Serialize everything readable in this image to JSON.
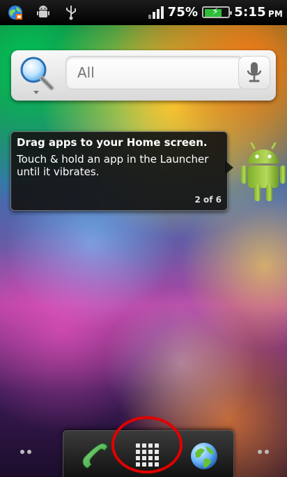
{
  "status_bar": {
    "battery_percent_text": "75%",
    "battery_level": 0.75,
    "time": "5:15",
    "time_suffix": "PM",
    "icons": [
      "browser-globe-icon",
      "android-notification-icon",
      "usb-icon",
      "signal-icon",
      "battery-charging-icon"
    ]
  },
  "search": {
    "placeholder": "All",
    "icons": [
      "search-magnifier-icon",
      "microphone-icon"
    ]
  },
  "tooltip": {
    "title": "Drag apps to your Home screen.",
    "body": "Touch & hold an app in the Launcher until it vibrates.",
    "counter": "2 of 6"
  },
  "dock": {
    "buttons": [
      {
        "name": "phone-button",
        "icon": "phone-icon"
      },
      {
        "name": "launcher-button",
        "icon": "app-grid-icon"
      },
      {
        "name": "browser-button",
        "icon": "globe-icon"
      }
    ]
  },
  "colors": {
    "highlight": "#e10000",
    "battery_green": "#2fbf3b",
    "phone_green": "#3aa53a"
  }
}
